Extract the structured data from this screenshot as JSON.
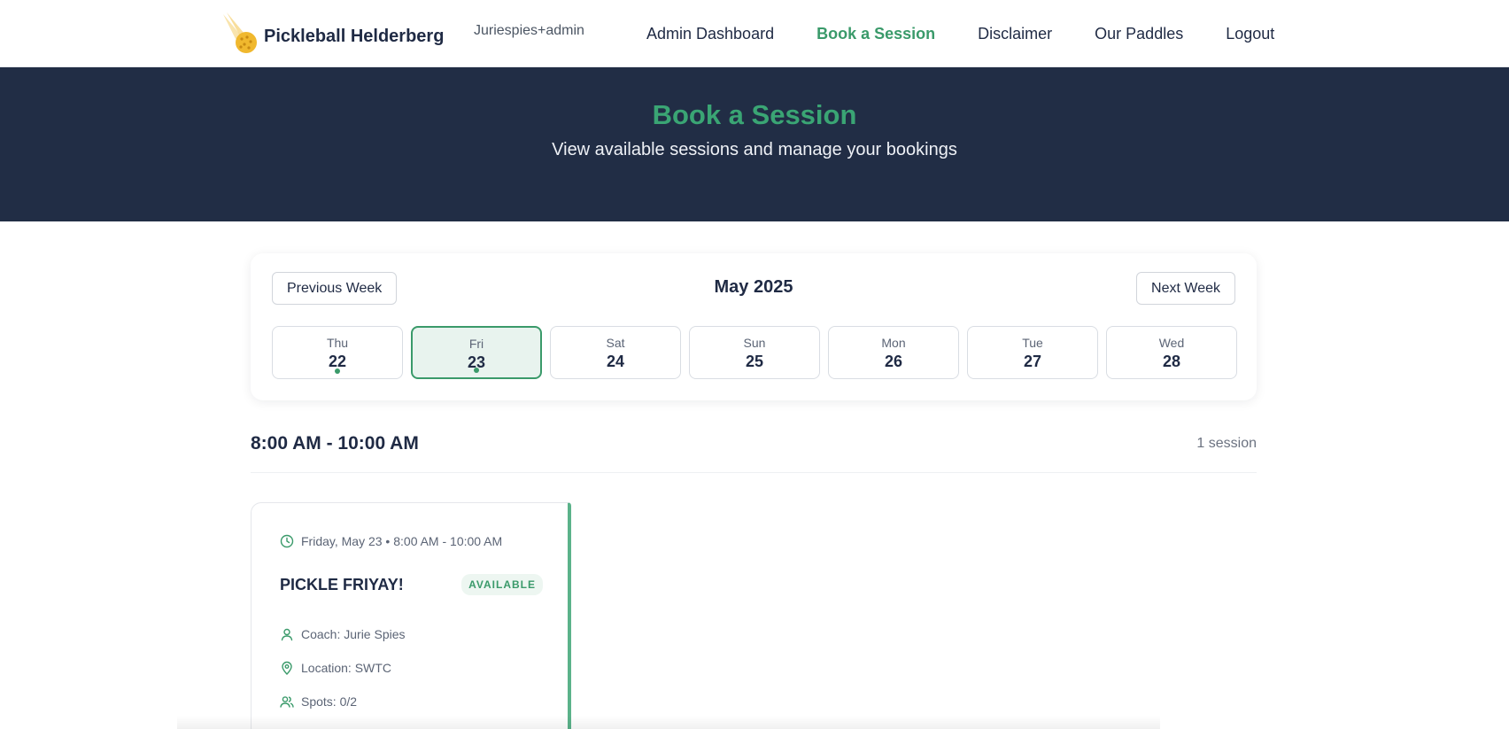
{
  "header": {
    "brand_name": "Pickleball Helderberg",
    "user": "Juriespies+admin",
    "nav": [
      {
        "label": "Admin Dashboard"
      },
      {
        "label": "Book a Session"
      },
      {
        "label": "Disclaimer"
      },
      {
        "label": "Our Paddles"
      },
      {
        "label": "Logout"
      }
    ],
    "active_nav": "Book a Session"
  },
  "hero": {
    "title": "Book a Session",
    "subtitle": "View available sessions and manage your bookings"
  },
  "calendar": {
    "prev_label": "Previous Week",
    "next_label": "Next Week",
    "month": "May 2025",
    "days": [
      {
        "name": "Thu",
        "num": "22",
        "has_session": true,
        "selected": false
      },
      {
        "name": "Fri",
        "num": "23",
        "has_session": true,
        "selected": true
      },
      {
        "name": "Sat",
        "num": "24",
        "has_session": false,
        "selected": false
      },
      {
        "name": "Sun",
        "num": "25",
        "has_session": false,
        "selected": false
      },
      {
        "name": "Mon",
        "num": "26",
        "has_session": false,
        "selected": false
      },
      {
        "name": "Tue",
        "num": "27",
        "has_session": false,
        "selected": false
      },
      {
        "name": "Wed",
        "num": "28",
        "has_session": false,
        "selected": false
      }
    ]
  },
  "slot": {
    "time_range": "8:00 AM - 10:00 AM",
    "count": "1 session"
  },
  "session": {
    "datetime": "Friday, May 23 • 8:00 AM - 10:00 AM",
    "title": "PICKLE FRIYAY!",
    "status": "AVAILABLE",
    "coach": "Coach: Jurie Spies",
    "location": "Location: SWTC",
    "spots": "Spots: 0/2"
  },
  "colors": {
    "accent": "#3a9a6a",
    "hero_bg": "#212d45",
    "text_dark": "#1f2a44"
  },
  "icons": {
    "logo": "pickleball-logo-icon",
    "time": "clock-icon",
    "coach": "user-icon",
    "location": "map-pin-icon",
    "spots": "users-icon"
  }
}
